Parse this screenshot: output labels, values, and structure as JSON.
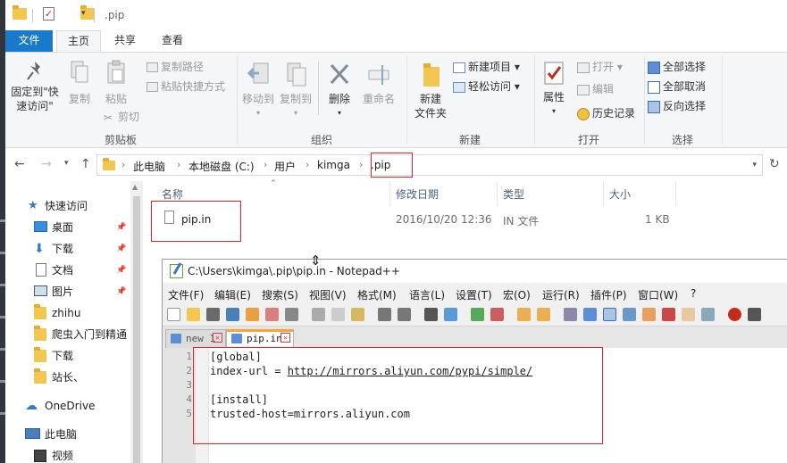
{
  "window": {
    "title": ".pip",
    "quick_access": {
      "folder_icon": "folder-icon",
      "properties_icon": "properties-icon",
      "new_folder_icon": "new-folder-icon",
      "dropdown_arrow": "▾"
    }
  },
  "tabs": [
    {
      "label": "文件"
    },
    {
      "label": "主页"
    },
    {
      "label": "共享"
    },
    {
      "label": "查看"
    }
  ],
  "ribbon": {
    "clipboard": {
      "group_label": "剪贴板",
      "pin_line1": "固定到\"快",
      "pin_line2": "速访问\"",
      "copy": "复制",
      "paste": "粘贴",
      "copy_path": "复制路径",
      "paste_shortcut": "粘贴快捷方式",
      "cut": "剪切"
    },
    "organize": {
      "group_label": "组织",
      "move_to": "移动到",
      "copy_to": "复制到",
      "delete": "删除",
      "rename": "重命名"
    },
    "new": {
      "group_label": "新建",
      "new_folder_line1": "新建",
      "new_folder_line2": "文件夹",
      "new_item": "新建项目 ▾",
      "easy_access": "轻松访问 ▾"
    },
    "open": {
      "group_label": "打开",
      "properties": "属性",
      "open": "打开 ▾",
      "edit": "编辑",
      "history": "历史记录"
    },
    "select": {
      "group_label": "选择",
      "select_all": "全部选择",
      "select_none": "全部取消",
      "invert": "反向选择"
    }
  },
  "address": {
    "crumbs": [
      "此电脑",
      "本地磁盘 (C:)",
      "用户",
      "kimga",
      ".pip"
    ],
    "separator": "›"
  },
  "nav_pane": {
    "items": [
      {
        "label": "快速访问",
        "icon": "star-icon"
      },
      {
        "label": "桌面",
        "icon": "desktop-icon",
        "pinned": true
      },
      {
        "label": "下载",
        "icon": "download-icon",
        "pinned": true
      },
      {
        "label": "文档",
        "icon": "document-icon",
        "pinned": true
      },
      {
        "label": "图片",
        "icon": "picture-icon",
        "pinned": true
      },
      {
        "label": "zhihu",
        "icon": "folder-icon"
      },
      {
        "label": "爬虫入门到精通",
        "icon": "folder-icon"
      },
      {
        "label": "下载",
        "icon": "folder-icon"
      },
      {
        "label": "站长、",
        "icon": "folder-icon"
      },
      {
        "label": "OneDrive",
        "icon": "cloud-icon"
      },
      {
        "label": "此电脑",
        "icon": "computer-icon"
      },
      {
        "label": "视频",
        "icon": "video-icon"
      }
    ]
  },
  "file_list": {
    "columns": [
      "名称",
      "修改日期",
      "类型",
      "大小"
    ],
    "rows": [
      {
        "name": "pip.in",
        "modified": "2016/10/20 12:36",
        "type": "IN 文件",
        "size": "1 KB"
      }
    ]
  },
  "notepad": {
    "title": "C:\\Users\\kimga\\.pip\\pip.in - Notepad++",
    "menu": [
      "文件(F)",
      "编辑(E)",
      "搜索(S)",
      "视图(V)",
      "格式(M)",
      "语言(L)",
      "设置(T)",
      "宏(O)",
      "运行(R)",
      "插件(P)",
      "窗口(W)",
      "?"
    ],
    "tabs": [
      {
        "label": "new 1"
      },
      {
        "label": "pip.in"
      }
    ],
    "lines": [
      {
        "num": "1",
        "text": "[global]"
      },
      {
        "num": "2",
        "text_prefix": "index-url = ",
        "url": "http://mirrors.aliyun.com/pypi/simple/"
      },
      {
        "num": "3",
        "text": ""
      },
      {
        "num": "4",
        "text": "[install]"
      },
      {
        "num": "5",
        "text": "trusted-host=mirrors.aliyun.com"
      }
    ]
  },
  "colors": {
    "file_tab": "#1979ca",
    "highlight_box": "#e0242a",
    "folder": "#f3c651"
  }
}
